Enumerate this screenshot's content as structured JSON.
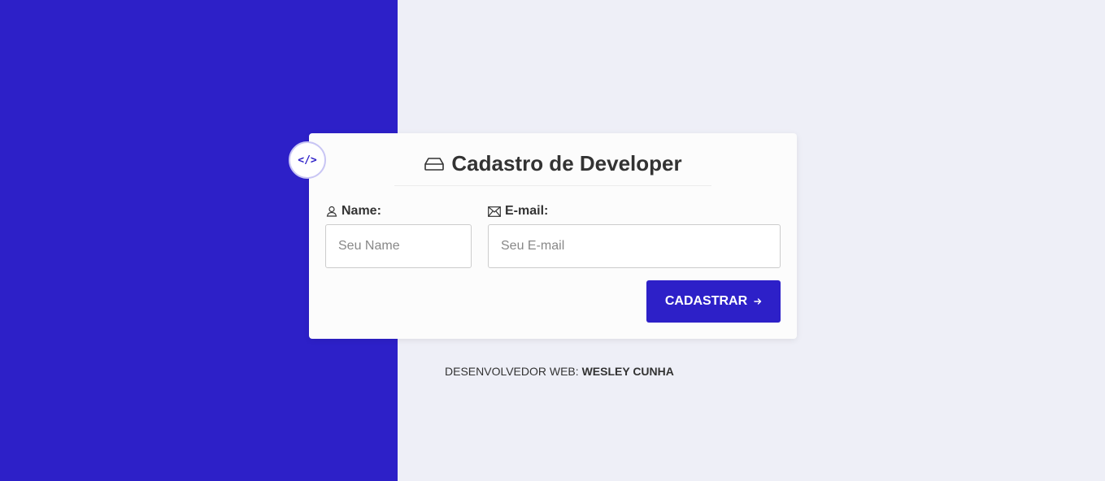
{
  "badge": {
    "text": "</>"
  },
  "form": {
    "title": "Cadastro de Developer",
    "name_label": "Name:",
    "name_placeholder": "Seu Name",
    "email_label": "E-mail:",
    "email_placeholder": "Seu E-mail",
    "submit_label": "CADASTRAR"
  },
  "footer": {
    "prefix": "DESENVOLVEDOR WEB:",
    "author": "WESLEY CUNHA"
  },
  "icons": {
    "badge": "code-icon",
    "title": "hard-drive-icon",
    "name": "user-icon",
    "email": "envelope-icon",
    "submit": "arrow-right-icon"
  },
  "colors": {
    "accent": "#2d20c8",
    "background": "#eeeff7",
    "card": "#fcfcfc"
  }
}
